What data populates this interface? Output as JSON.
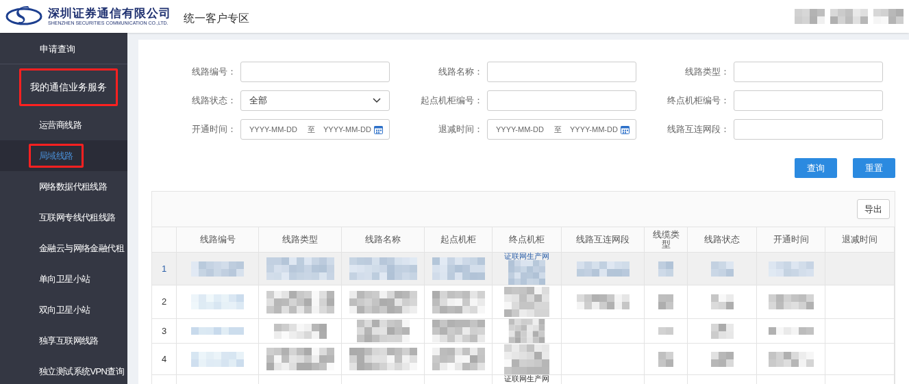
{
  "header": {
    "company_name": "深圳证券通信有限公司",
    "company_name_en": "SHENZHEN SECURITIES COMMUNICATION CO.,LTD.",
    "portal_title": "统一客户专区"
  },
  "sidebar": {
    "items": [
      {
        "label": "申请查询",
        "kind": "top",
        "selected": false,
        "highlighted": false
      },
      {
        "label": "我的通信业务服务",
        "kind": "group",
        "selected": false,
        "highlighted": true
      },
      {
        "label": "运营商线路",
        "kind": "child",
        "selected": false,
        "highlighted": false
      },
      {
        "label": "局域线路",
        "kind": "child",
        "selected": true,
        "highlighted": true
      },
      {
        "label": "网络数据代租线路",
        "kind": "child",
        "selected": false,
        "highlighted": false
      },
      {
        "label": "互联网专线代租线路",
        "kind": "child",
        "selected": false,
        "highlighted": false
      },
      {
        "label": "金融云与网络金融代租",
        "kind": "child",
        "selected": false,
        "highlighted": false
      },
      {
        "label": "单向卫星小站",
        "kind": "child",
        "selected": false,
        "highlighted": false
      },
      {
        "label": "双向卫星小站",
        "kind": "child",
        "selected": false,
        "highlighted": false
      },
      {
        "label": "独享互联网线路",
        "kind": "child",
        "selected": false,
        "highlighted": false
      },
      {
        "label": "独立测试系统VPN查询",
        "kind": "child",
        "selected": false,
        "highlighted": false
      }
    ]
  },
  "filters": [
    {
      "label": "线路编号：",
      "kind": "text"
    },
    {
      "label": "线路名称：",
      "kind": "text"
    },
    {
      "label": "线路类型：",
      "kind": "text"
    },
    {
      "label": "线路状态：",
      "kind": "select",
      "value": "全部"
    },
    {
      "label": "起点机柜编号：",
      "kind": "text"
    },
    {
      "label": "终点机柜编号：",
      "kind": "text"
    },
    {
      "label": "开通时间：",
      "kind": "daterange",
      "start_placeholder": "YYYY-MM-DD",
      "separator": "至",
      "end_placeholder": "YYYY-MM-DD"
    },
    {
      "label": "退减时间：",
      "kind": "daterange",
      "start_placeholder": "YYYY-MM-DD",
      "separator": "至",
      "end_placeholder": "YYYY-MM-DD"
    },
    {
      "label": "线路互连网段：",
      "kind": "text"
    }
  ],
  "buttons": [
    "查询",
    "重置"
  ],
  "table": {
    "export_button": "导出",
    "columns": [
      "线路编号",
      "线路类型",
      "线路名称",
      "起点机柜",
      "终点机柜",
      "线路互连网段",
      "线缆类型",
      "线路状态",
      "开通时间",
      "退减时间"
    ],
    "rows": [
      {
        "index": "1",
        "selected": true,
        "end_cabinet": "证联网生产网"
      },
      {
        "index": "2",
        "selected": false
      },
      {
        "index": "3",
        "selected": false
      },
      {
        "index": "4",
        "selected": false
      },
      {
        "selected": false,
        "end_cabinet": "证联网生产网"
      }
    ]
  }
}
